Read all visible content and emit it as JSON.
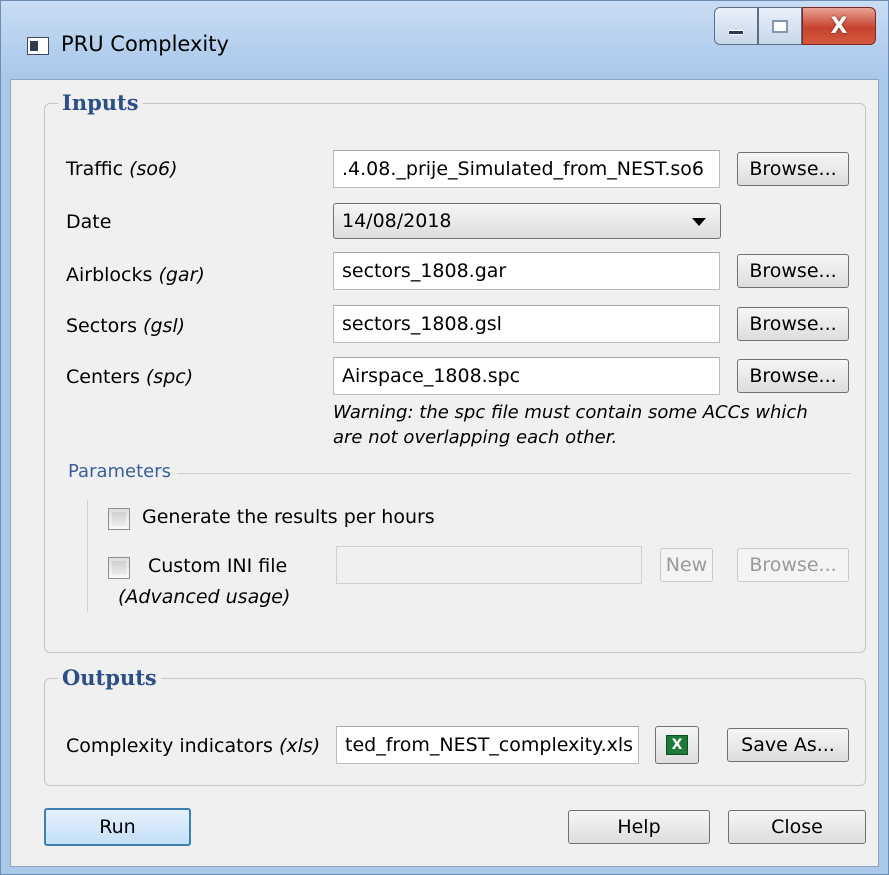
{
  "window": {
    "title": "PRU Complexity",
    "close_glyph": "X",
    "icons": [
      "app-icon",
      "minimize-icon",
      "maximize-icon",
      "close-icon"
    ]
  },
  "inputs": {
    "group_title": "Inputs",
    "traffic": {
      "label": "Traffic ",
      "hint": "(so6)",
      "value": ".4.08._prije_Simulated_from_NEST.so6",
      "browse": "Browse..."
    },
    "date": {
      "label": "Date",
      "value": "14/08/2018"
    },
    "airblocks": {
      "label": "Airblocks ",
      "hint": "(gar)",
      "value": "sectors_1808.gar",
      "browse": "Browse..."
    },
    "sectors": {
      "label": "Sectors ",
      "hint": "(gsl)",
      "value": "sectors_1808.gsl",
      "browse": "Browse..."
    },
    "centers": {
      "label": "Centers ",
      "hint": "(spc)",
      "value": "Airspace_1808.spc",
      "browse": "Browse..."
    },
    "warning_line1": "Warning: the spc file must contain some ACCs which",
    "warning_line2": "are not overlapping each other."
  },
  "parameters": {
    "title": "Parameters",
    "per_hours_label": "Generate the results per hours",
    "custom_ini_label": "Custom INI file",
    "advanced_label": "(Advanced usage)",
    "ini_value": "",
    "new_button": "New",
    "browse_button": "Browse..."
  },
  "outputs": {
    "group_title": "Outputs",
    "complexity_label": "Complexity indicators ",
    "complexity_hint": "(xls)",
    "complexity_value": "ted_from_NEST_complexity.xls",
    "excel_glyph": "X",
    "save_as_button": "Save As..."
  },
  "footer": {
    "run_button": "Run",
    "help_button": "Help",
    "close_button": "Close"
  },
  "colors": {
    "group_title": "#2c4f86",
    "parameters_title": "#3a5f99",
    "excel_green": "#1e7a3a",
    "close_red": "#c7432d"
  }
}
